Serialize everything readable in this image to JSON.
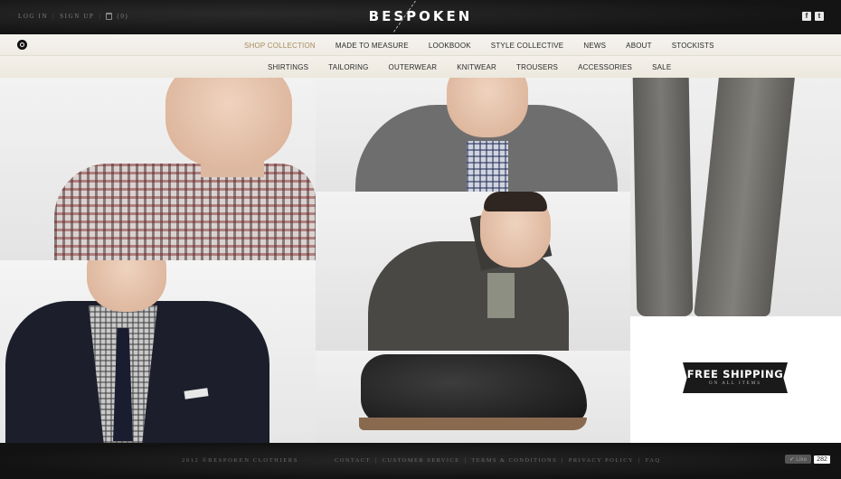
{
  "header": {
    "account": {
      "login_label": "LOG IN",
      "signup_label": "SIGN UP",
      "bag_count": "(0)"
    },
    "logo": "BESPOKEN",
    "social": [
      {
        "icon": "facebook-icon",
        "glyph": "f"
      },
      {
        "icon": "twitter-icon",
        "glyph": "t"
      }
    ]
  },
  "nav": {
    "primary": [
      {
        "label": "SHOP COLLECTION",
        "active": true
      },
      {
        "label": "MADE TO MEASURE"
      },
      {
        "label": "LOOKBOOK"
      },
      {
        "label": "STYLE COLLECTIVE"
      },
      {
        "label": "NEWS"
      },
      {
        "label": "ABOUT"
      },
      {
        "label": "STOCKISTS"
      }
    ],
    "secondary": [
      {
        "label": "SHIRTINGS"
      },
      {
        "label": "TAILORING"
      },
      {
        "label": "OUTERWEAR"
      },
      {
        "label": "KNITWEAR"
      },
      {
        "label": "TROUSERS"
      },
      {
        "label": "ACCESSORIES"
      },
      {
        "label": "SALE"
      }
    ]
  },
  "promo": {
    "title": "FREE SHIPPING",
    "subtitle": "ON ALL ITEMS"
  },
  "footer": {
    "copyright": "2012 ©BESPOKEN CLOTHIERS",
    "links": [
      "CONTACT",
      "CUSTOMER SERVICE",
      "TERMS & CONDITIONS",
      "PRIVACY POLICY",
      "FAQ"
    ],
    "like_label": "Like",
    "like_count": "282"
  },
  "colors": {
    "accent": "#a78b5f",
    "header_bg": "#141414",
    "nav_bg": "#f2efe8"
  }
}
